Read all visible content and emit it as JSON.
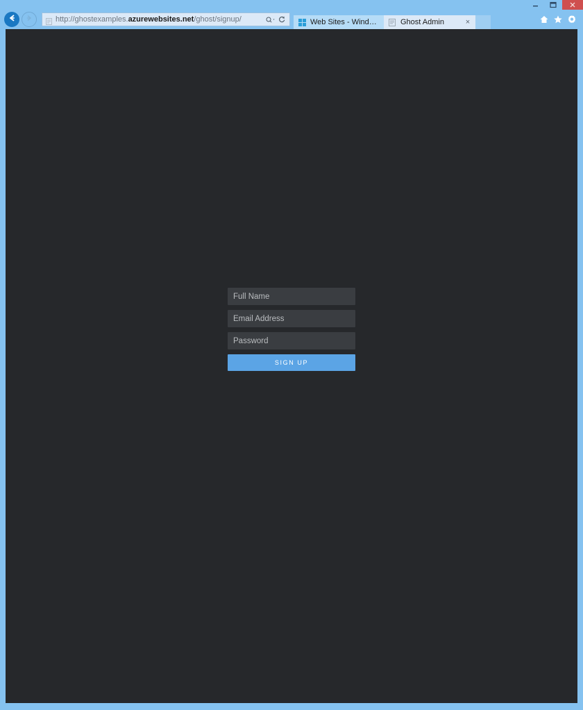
{
  "window": {
    "controls": [
      {
        "name": "minimize",
        "glyph": "minimize-icon"
      },
      {
        "name": "restore",
        "glyph": "restore-icon"
      },
      {
        "name": "close",
        "glyph": "close-icon"
      }
    ]
  },
  "navigation": {
    "back_icon": "back-arrow-icon",
    "forward_icon": "forward-arrow-icon",
    "page_icon": "page-icon",
    "url_prefix": "http://ghostexamples.",
    "url_domain": "azurewebsites.net",
    "url_suffix": "/ghost/signup/",
    "url_full": "http://ghostexamples.azurewebsites.net/ghost/signup/",
    "search_icon": "search-dropdown-icon",
    "refresh_icon": "refresh-icon"
  },
  "tabs": [
    {
      "label": "Web Sites - Windows Azure",
      "icon": "windows-azure-icon",
      "active": false,
      "closable": false
    },
    {
      "label": "Ghost Admin",
      "icon": "page-icon",
      "active": true,
      "closable": true,
      "close_label": "×"
    }
  ],
  "toolbar": {
    "home_icon": "home-icon",
    "favorites_icon": "star-icon",
    "settings_icon": "gear-icon"
  },
  "page": {
    "background_color": "#26282b",
    "signup": {
      "full_name_placeholder": "Full Name",
      "full_name_value": "",
      "email_placeholder": "Email Address",
      "email_value": "",
      "password_placeholder": "Password",
      "password_value": "",
      "submit_label": "Sign Up",
      "accent_color": "#5ba4e5",
      "field_color": "#3a3d41"
    }
  }
}
